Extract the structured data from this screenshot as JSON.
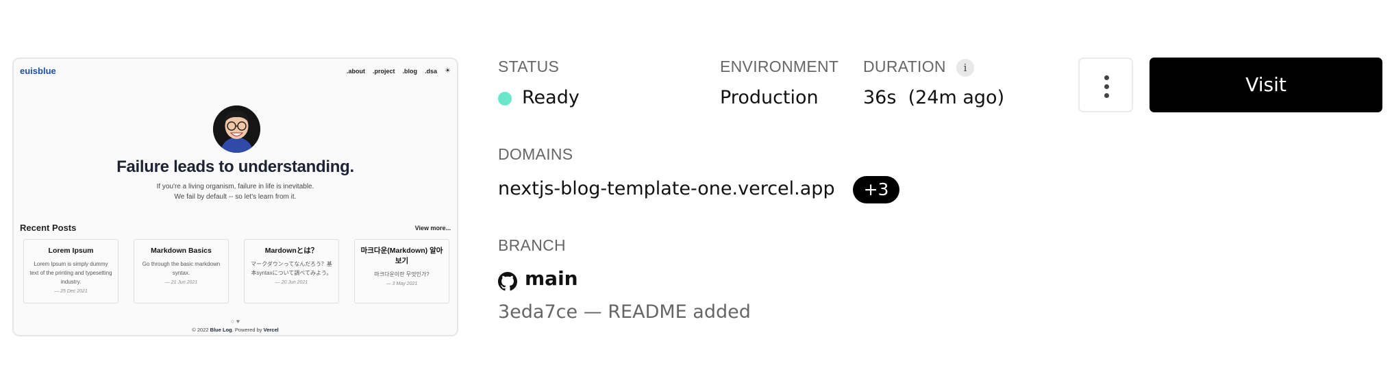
{
  "preview": {
    "brand": "euisblue",
    "nav": [
      ".about",
      ".project",
      ".blog",
      ".dsa"
    ],
    "theme_toggle": "☀",
    "hero_title": "Failure leads to understanding.",
    "hero_sub_1": "If you're a living organism, failure in life is inevitable.",
    "hero_sub_2": "We fail by default -- so let's learn from it.",
    "recent_posts_title": "Recent Posts",
    "view_more": "View more...",
    "posts": [
      {
        "title": "Lorem Ipsum",
        "desc": "Lorem Ipsum is simply dummy text of the printing and typesetting industry.",
        "date": "— 25 Dec 2021"
      },
      {
        "title": "Markdown Basics",
        "desc": "Go through the basic markdown syntax.",
        "date": "— 21 Jun 2021"
      },
      {
        "title": "Mardownとは？",
        "desc": "マークダウンってなんだろう？基本syntaxについて調べてみよう。",
        "date": "— 20 Jun 2021"
      },
      {
        "title": "마크다운(Markdown) 알아보기",
        "desc": "마크다운이란 무엇인가?",
        "date": "— 3 May 2021"
      }
    ],
    "footer_icons": "○ ♥",
    "footer_copy": "© 2022",
    "footer_blog": "Blue Log",
    "footer_powered": ". Powered by",
    "footer_vercel": "Vercel"
  },
  "status": {
    "label": "STATUS",
    "value": "Ready",
    "color": "#50e3c2"
  },
  "environment": {
    "label": "ENVIRONMENT",
    "value": "Production"
  },
  "duration": {
    "label": "DURATION",
    "info_icon": "i",
    "value": "36s  (24m ago)"
  },
  "domains": {
    "label": "DOMAINS",
    "value": "nextjs-blog-template-one.vercel.app",
    "extra": "+3"
  },
  "branch": {
    "label": "BRANCH",
    "name": "main",
    "commit": "3eda7ce — README added"
  },
  "actions": {
    "visit": "Visit"
  }
}
